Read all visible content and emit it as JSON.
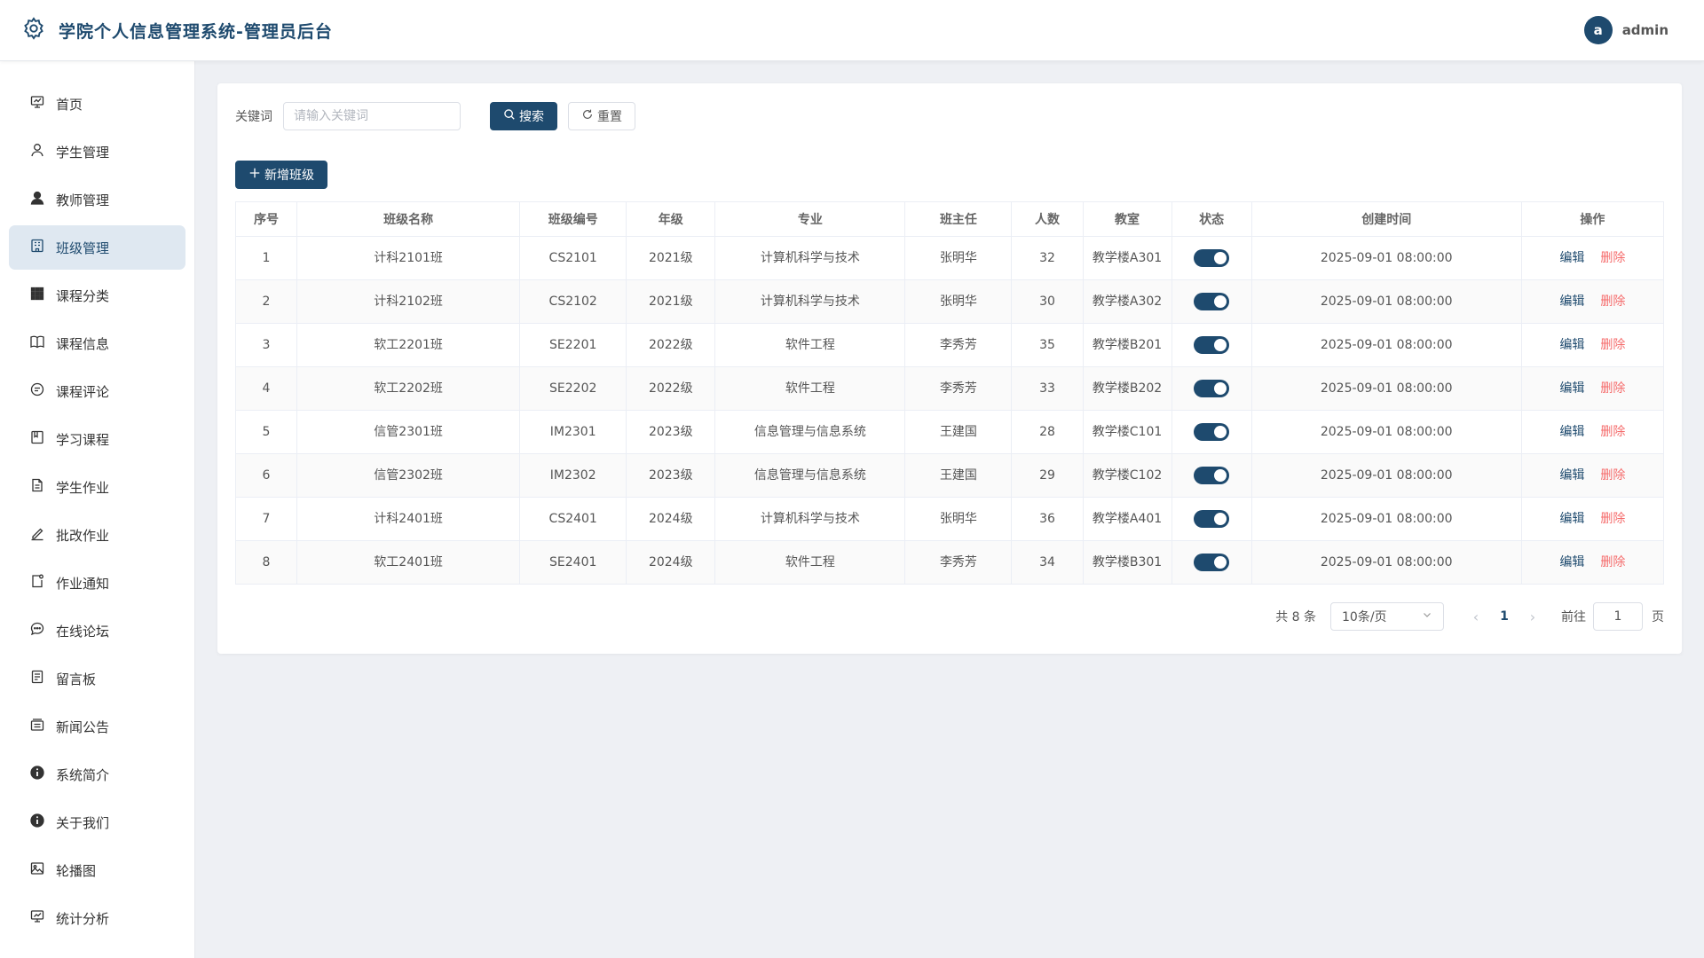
{
  "header": {
    "title": "学院个人信息管理系统-管理员后台",
    "icon": "gear-icon",
    "user": {
      "avatar_letter": "a",
      "name": "admin"
    }
  },
  "sidebar": {
    "items": [
      {
        "label": "首页",
        "icon": "dashboard-icon",
        "active": false
      },
      {
        "label": "学生管理",
        "icon": "user-outline-icon",
        "active": false
      },
      {
        "label": "教师管理",
        "icon": "user-filled-icon",
        "active": false
      },
      {
        "label": "班级管理",
        "icon": "building-icon",
        "active": true
      },
      {
        "label": "课程分类",
        "icon": "grid-icon",
        "active": false
      },
      {
        "label": "课程信息",
        "icon": "book-icon",
        "active": false
      },
      {
        "label": "课程评论",
        "icon": "comment-icon",
        "active": false
      },
      {
        "label": "学习课程",
        "icon": "course-icon",
        "active": false
      },
      {
        "label": "学生作业",
        "icon": "document-icon",
        "active": false
      },
      {
        "label": "批改作业",
        "icon": "pen-icon",
        "active": false
      },
      {
        "label": "作业通知",
        "icon": "notice-icon",
        "active": false
      },
      {
        "label": "在线论坛",
        "icon": "chat-icon",
        "active": false
      },
      {
        "label": "留言板",
        "icon": "memo-icon",
        "active": false
      },
      {
        "label": "新闻公告",
        "icon": "news-icon",
        "active": false
      },
      {
        "label": "系统简介",
        "icon": "info-icon",
        "active": false
      },
      {
        "label": "关于我们",
        "icon": "info-icon",
        "active": false
      },
      {
        "label": "轮播图",
        "icon": "image-icon",
        "active": false
      },
      {
        "label": "统计分析",
        "icon": "chart-icon",
        "active": false
      }
    ]
  },
  "search": {
    "label": "关键词",
    "placeholder": "请输入关键词",
    "search_button": "搜索",
    "reset_button": "重置"
  },
  "add_button": "新增班级",
  "table": {
    "columns": [
      "序号",
      "班级名称",
      "班级编号",
      "年级",
      "专业",
      "班主任",
      "人数",
      "教室",
      "状态",
      "创建时间",
      "操作"
    ],
    "rows": [
      {
        "no": "1",
        "name": "计科2101班",
        "code": "CS2101",
        "grade": "2021级",
        "major": "计算机科学与技术",
        "teacher": "张明华",
        "count": "32",
        "room": "教学楼A301",
        "status_on": true,
        "created": "2025-09-01 08:00:00"
      },
      {
        "no": "2",
        "name": "计科2102班",
        "code": "CS2102",
        "grade": "2021级",
        "major": "计算机科学与技术",
        "teacher": "张明华",
        "count": "30",
        "room": "教学楼A302",
        "status_on": true,
        "created": "2025-09-01 08:00:00"
      },
      {
        "no": "3",
        "name": "软工2201班",
        "code": "SE2201",
        "grade": "2022级",
        "major": "软件工程",
        "teacher": "李秀芳",
        "count": "35",
        "room": "教学楼B201",
        "status_on": true,
        "created": "2025-09-01 08:00:00"
      },
      {
        "no": "4",
        "name": "软工2202班",
        "code": "SE2202",
        "grade": "2022级",
        "major": "软件工程",
        "teacher": "李秀芳",
        "count": "33",
        "room": "教学楼B202",
        "status_on": true,
        "created": "2025-09-01 08:00:00"
      },
      {
        "no": "5",
        "name": "信管2301班",
        "code": "IM2301",
        "grade": "2023级",
        "major": "信息管理与信息系统",
        "teacher": "王建国",
        "count": "28",
        "room": "教学楼C101",
        "status_on": true,
        "created": "2025-09-01 08:00:00"
      },
      {
        "no": "6",
        "name": "信管2302班",
        "code": "IM2302",
        "grade": "2023级",
        "major": "信息管理与信息系统",
        "teacher": "王建国",
        "count": "29",
        "room": "教学楼C102",
        "status_on": true,
        "created": "2025-09-01 08:00:00"
      },
      {
        "no": "7",
        "name": "计科2401班",
        "code": "CS2401",
        "grade": "2024级",
        "major": "计算机科学与技术",
        "teacher": "张明华",
        "count": "36",
        "room": "教学楼A401",
        "status_on": true,
        "created": "2025-09-01 08:00:00"
      },
      {
        "no": "8",
        "name": "软工2401班",
        "code": "SE2401",
        "grade": "2024级",
        "major": "软件工程",
        "teacher": "李秀芳",
        "count": "34",
        "room": "教学楼B301",
        "status_on": true,
        "created": "2025-09-01 08:00:00"
      }
    ],
    "edit_label": "编辑",
    "delete_label": "删除"
  },
  "pagination": {
    "total_text": "共 8 条",
    "page_size": "10条/页",
    "current_page": "1",
    "goto_label": "前往",
    "goto_value": "1",
    "goto_suffix": "页"
  },
  "colors": {
    "primary": "#1e4a6e",
    "danger": "#f56c6c",
    "active_nav_bg": "#dfe8f1"
  }
}
